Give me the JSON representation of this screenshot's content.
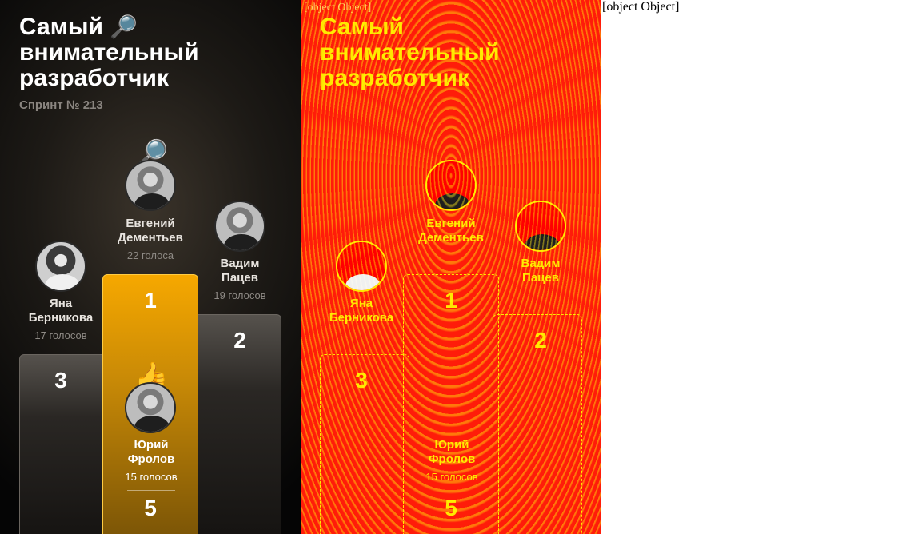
{
  "card": {
    "title_lines": [
      "Самый",
      "внимательный",
      "разработчик"
    ],
    "title_emoji": "🔎",
    "subtitle": "Спринт № 213"
  },
  "winner_badge_emoji": "🔎",
  "podium": [
    {
      "place": "3",
      "name_first": "Яна",
      "name_last": "Берникова",
      "votes": "17 голосов"
    },
    {
      "place": "1",
      "name_first": "Евгений",
      "name_last": "Дементьев",
      "votes": "22 голоса"
    },
    {
      "place": "2",
      "name_first": "Вадим",
      "name_last": "Пацев",
      "votes": "19 голосов"
    }
  ],
  "current_user": {
    "emoji": "👍",
    "name_first": "Юрий",
    "name_last": "Фролов",
    "votes": "15 голосов",
    "place": "5"
  },
  "object_label": "[object Object]",
  "diff_label": "[object Object]",
  "colors": {
    "gold": "#f6a800",
    "diff_red": "#ff1c0a",
    "highlight": "#ffe36b"
  }
}
